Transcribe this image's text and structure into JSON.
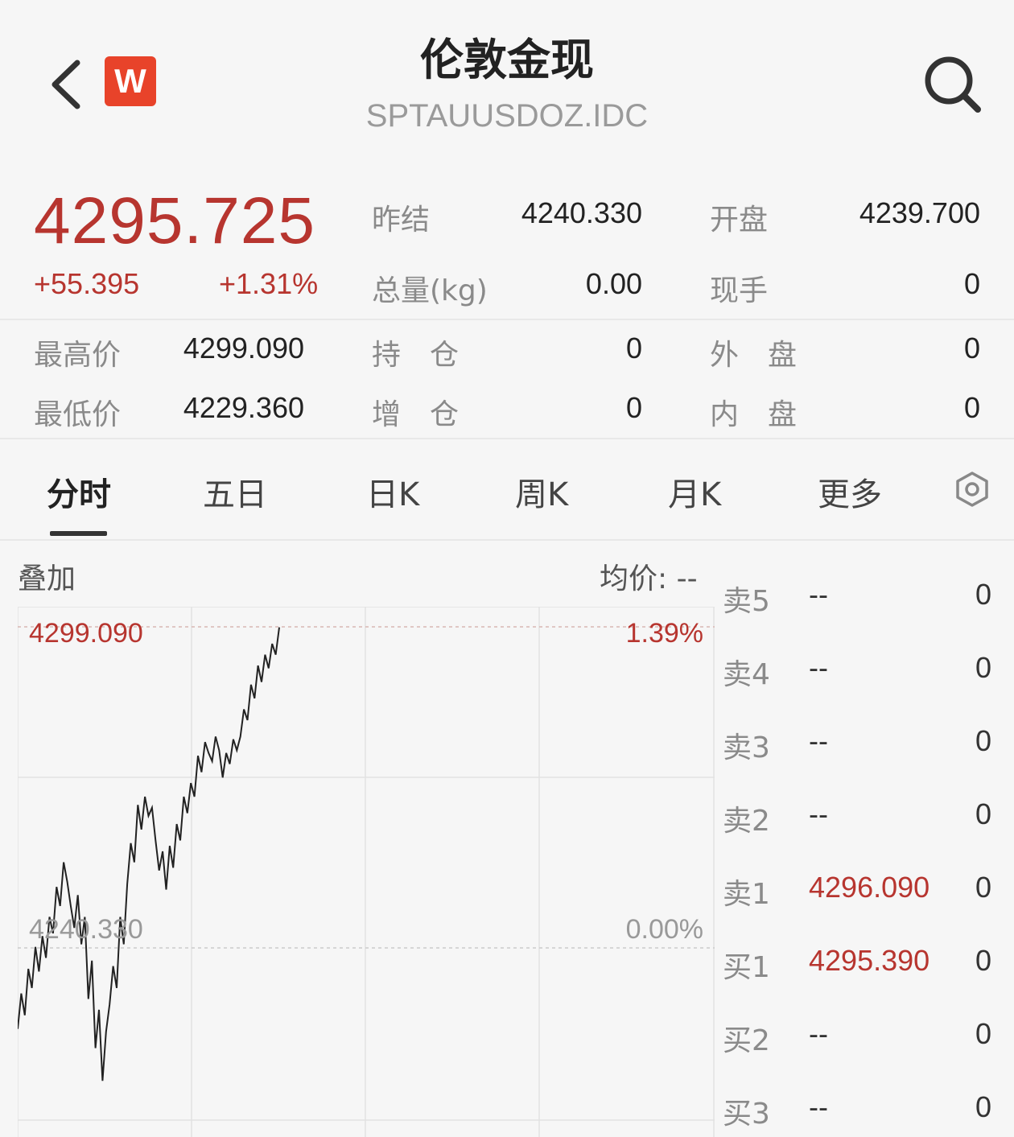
{
  "header": {
    "title": "伦敦金现",
    "code": "SPTAUUSDOZ.IDC",
    "logo_letter": "W"
  },
  "quote": {
    "price": "4295.725",
    "change": "+55.395",
    "change_pct": "+1.31%",
    "color_up": "#b7352f"
  },
  "stats": {
    "prev_settle_label": "昨结",
    "prev_settle": "4240.330",
    "open_label": "开盘",
    "open": "4239.700",
    "volume_label": "总量(kg)",
    "volume": "0.00",
    "current_hand_label": "现手",
    "current_hand": "0",
    "high_label": "最高价",
    "high": "4299.090",
    "position_label": "持　仓",
    "position": "0",
    "outer_label": "外　盘",
    "outer": "0",
    "low_label": "最低价",
    "low": "4229.360",
    "increase_label": "增　仓",
    "increase": "0",
    "inner_label": "内　盘",
    "inner": "0"
  },
  "tabs": [
    "分时",
    "五日",
    "日K",
    "周K",
    "月K",
    "更多"
  ],
  "chart_controls": {
    "overlay_label": "叠加",
    "avg_label": "均价: --"
  },
  "chart_data": {
    "type": "line",
    "top_label": "4299.090",
    "top_pct": "1.39%",
    "base_label": "4240.330",
    "base_pct": "0.00%",
    "ylim": [
      4181.57,
      4299.09
    ],
    "y_base": 4240.33,
    "series": [
      {
        "values": [
          4225.5,
          4232.0,
          4228.0,
          4236.5,
          4233.0,
          4240.5,
          4236.0,
          4242.5,
          4238.5,
          4246.0,
          4243.0,
          4251.5,
          4248.0,
          4256.0,
          4252.5,
          4248.0,
          4244.0,
          4250.0,
          4241.0,
          4246.0,
          4231.0,
          4238.0,
          4222.0,
          4229.0,
          4216.0,
          4225.0,
          4230.0,
          4237.0,
          4233.0,
          4246.0,
          4241.0,
          4252.0,
          4259.5,
          4256.0,
          4266.5,
          4262.0,
          4268.0,
          4264.5,
          4266.0,
          4260.0,
          4254.5,
          4258.0,
          4251.0,
          4259.0,
          4255.0,
          4263.0,
          4260.0,
          4268.0,
          4265.0,
          4270.5,
          4268.0,
          4275.5,
          4272.5,
          4278.0,
          4276.0,
          4274.5,
          4279.0,
          4276.5,
          4271.5,
          4276.0,
          4274.0,
          4278.5,
          4276.5,
          4279.0,
          4284.0,
          4282.0,
          4288.5,
          4286.0,
          4292.0,
          4289.0,
          4294.0,
          4291.5,
          4296.0,
          4294.0,
          4299.0
        ]
      }
    ],
    "grid": true
  },
  "orderbook": [
    {
      "side": "卖5",
      "price": "--",
      "vol": "0",
      "red": false
    },
    {
      "side": "卖4",
      "price": "--",
      "vol": "0",
      "red": false
    },
    {
      "side": "卖3",
      "price": "--",
      "vol": "0",
      "red": false
    },
    {
      "side": "卖2",
      "price": "--",
      "vol": "0",
      "red": false
    },
    {
      "side": "卖1",
      "price": "4296.090",
      "vol": "0",
      "red": true
    },
    {
      "side": "买1",
      "price": "4295.390",
      "vol": "0",
      "red": true
    },
    {
      "side": "买2",
      "price": "--",
      "vol": "0",
      "red": false
    },
    {
      "side": "买3",
      "price": "--",
      "vol": "0",
      "red": false
    }
  ]
}
